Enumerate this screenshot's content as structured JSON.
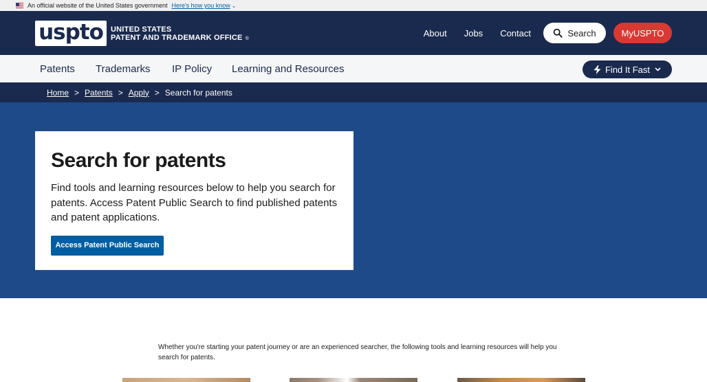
{
  "gov_banner": {
    "text": "An official website of the United States government",
    "link": "Here's how you know",
    "chevron": "⌄"
  },
  "header": {
    "logo": "uspto",
    "agency_line1": "UNITED STATES",
    "agency_line2": "PATENT AND TRADEMARK OFFICE",
    "registered": "®",
    "links": [
      "About",
      "Jobs",
      "Contact"
    ],
    "search_label": "Search",
    "myuspto_label": "MyUSPTO"
  },
  "main_nav": {
    "items": [
      "Patents",
      "Trademarks",
      "IP Policy",
      "Learning and Resources"
    ],
    "find_it_fast": "Find It Fast"
  },
  "breadcrumb": {
    "items": [
      "Home",
      "Patents",
      "Apply"
    ],
    "current": "Search for patents",
    "separator": ">"
  },
  "hero": {
    "title": "Search for patents",
    "description": "Find tools and learning resources below to help you search for patents. Access Patent Public Search to find published patents and patent applications.",
    "button": "Access Patent Public Search"
  },
  "intro": {
    "text": "Whether you're starting your patent journey or are an experienced searcher, the following tools and learning resources will help you search for patents."
  },
  "colors": {
    "header_bg": "#1a2a4e",
    "hero_bg": "#1f4a8a",
    "accent_red": "#d83933",
    "button_blue": "#005ea2",
    "nav_bg": "#f5f6f7"
  }
}
